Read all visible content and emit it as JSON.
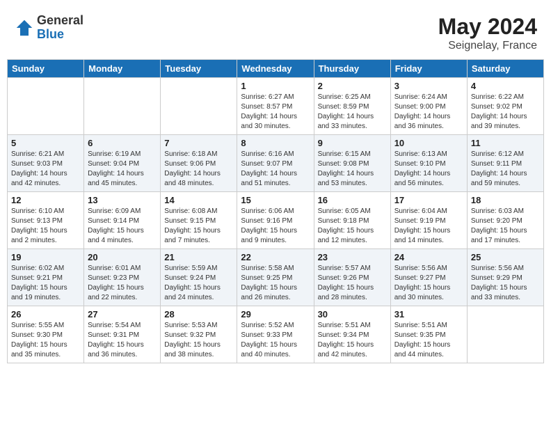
{
  "header": {
    "logo_general": "General",
    "logo_blue": "Blue",
    "month_year": "May 2024",
    "location": "Seignelay, France"
  },
  "weekdays": [
    "Sunday",
    "Monday",
    "Tuesday",
    "Wednesday",
    "Thursday",
    "Friday",
    "Saturday"
  ],
  "weeks": [
    [
      {
        "day": "",
        "info": ""
      },
      {
        "day": "",
        "info": ""
      },
      {
        "day": "",
        "info": ""
      },
      {
        "day": "1",
        "info": "Sunrise: 6:27 AM\nSunset: 8:57 PM\nDaylight: 14 hours\nand 30 minutes."
      },
      {
        "day": "2",
        "info": "Sunrise: 6:25 AM\nSunset: 8:59 PM\nDaylight: 14 hours\nand 33 minutes."
      },
      {
        "day": "3",
        "info": "Sunrise: 6:24 AM\nSunset: 9:00 PM\nDaylight: 14 hours\nand 36 minutes."
      },
      {
        "day": "4",
        "info": "Sunrise: 6:22 AM\nSunset: 9:02 PM\nDaylight: 14 hours\nand 39 minutes."
      }
    ],
    [
      {
        "day": "5",
        "info": "Sunrise: 6:21 AM\nSunset: 9:03 PM\nDaylight: 14 hours\nand 42 minutes."
      },
      {
        "day": "6",
        "info": "Sunrise: 6:19 AM\nSunset: 9:04 PM\nDaylight: 14 hours\nand 45 minutes."
      },
      {
        "day": "7",
        "info": "Sunrise: 6:18 AM\nSunset: 9:06 PM\nDaylight: 14 hours\nand 48 minutes."
      },
      {
        "day": "8",
        "info": "Sunrise: 6:16 AM\nSunset: 9:07 PM\nDaylight: 14 hours\nand 51 minutes."
      },
      {
        "day": "9",
        "info": "Sunrise: 6:15 AM\nSunset: 9:08 PM\nDaylight: 14 hours\nand 53 minutes."
      },
      {
        "day": "10",
        "info": "Sunrise: 6:13 AM\nSunset: 9:10 PM\nDaylight: 14 hours\nand 56 minutes."
      },
      {
        "day": "11",
        "info": "Sunrise: 6:12 AM\nSunset: 9:11 PM\nDaylight: 14 hours\nand 59 minutes."
      }
    ],
    [
      {
        "day": "12",
        "info": "Sunrise: 6:10 AM\nSunset: 9:13 PM\nDaylight: 15 hours\nand 2 minutes."
      },
      {
        "day": "13",
        "info": "Sunrise: 6:09 AM\nSunset: 9:14 PM\nDaylight: 15 hours\nand 4 minutes."
      },
      {
        "day": "14",
        "info": "Sunrise: 6:08 AM\nSunset: 9:15 PM\nDaylight: 15 hours\nand 7 minutes."
      },
      {
        "day": "15",
        "info": "Sunrise: 6:06 AM\nSunset: 9:16 PM\nDaylight: 15 hours\nand 9 minutes."
      },
      {
        "day": "16",
        "info": "Sunrise: 6:05 AM\nSunset: 9:18 PM\nDaylight: 15 hours\nand 12 minutes."
      },
      {
        "day": "17",
        "info": "Sunrise: 6:04 AM\nSunset: 9:19 PM\nDaylight: 15 hours\nand 14 minutes."
      },
      {
        "day": "18",
        "info": "Sunrise: 6:03 AM\nSunset: 9:20 PM\nDaylight: 15 hours\nand 17 minutes."
      }
    ],
    [
      {
        "day": "19",
        "info": "Sunrise: 6:02 AM\nSunset: 9:21 PM\nDaylight: 15 hours\nand 19 minutes."
      },
      {
        "day": "20",
        "info": "Sunrise: 6:01 AM\nSunset: 9:23 PM\nDaylight: 15 hours\nand 22 minutes."
      },
      {
        "day": "21",
        "info": "Sunrise: 5:59 AM\nSunset: 9:24 PM\nDaylight: 15 hours\nand 24 minutes."
      },
      {
        "day": "22",
        "info": "Sunrise: 5:58 AM\nSunset: 9:25 PM\nDaylight: 15 hours\nand 26 minutes."
      },
      {
        "day": "23",
        "info": "Sunrise: 5:57 AM\nSunset: 9:26 PM\nDaylight: 15 hours\nand 28 minutes."
      },
      {
        "day": "24",
        "info": "Sunrise: 5:56 AM\nSunset: 9:27 PM\nDaylight: 15 hours\nand 30 minutes."
      },
      {
        "day": "25",
        "info": "Sunrise: 5:56 AM\nSunset: 9:29 PM\nDaylight: 15 hours\nand 33 minutes."
      }
    ],
    [
      {
        "day": "26",
        "info": "Sunrise: 5:55 AM\nSunset: 9:30 PM\nDaylight: 15 hours\nand 35 minutes."
      },
      {
        "day": "27",
        "info": "Sunrise: 5:54 AM\nSunset: 9:31 PM\nDaylight: 15 hours\nand 36 minutes."
      },
      {
        "day": "28",
        "info": "Sunrise: 5:53 AM\nSunset: 9:32 PM\nDaylight: 15 hours\nand 38 minutes."
      },
      {
        "day": "29",
        "info": "Sunrise: 5:52 AM\nSunset: 9:33 PM\nDaylight: 15 hours\nand 40 minutes."
      },
      {
        "day": "30",
        "info": "Sunrise: 5:51 AM\nSunset: 9:34 PM\nDaylight: 15 hours\nand 42 minutes."
      },
      {
        "day": "31",
        "info": "Sunrise: 5:51 AM\nSunset: 9:35 PM\nDaylight: 15 hours\nand 44 minutes."
      },
      {
        "day": "",
        "info": ""
      }
    ]
  ]
}
